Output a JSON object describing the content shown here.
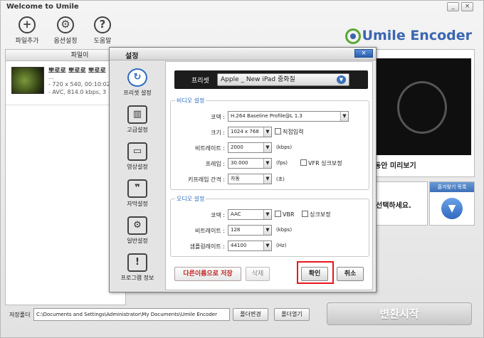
{
  "window": {
    "title": "Welcome to Umile",
    "min": "_",
    "close": "×"
  },
  "toolbar": {
    "add_file": "파일추가",
    "options": "옵션설정",
    "help": "도움말",
    "add_icon": "+",
    "options_icon": "⚙",
    "help_icon": "?"
  },
  "logo": {
    "text": "Umile Encoder",
    "accent": "#5aa832",
    "brand": "#3a66b0"
  },
  "file_panel": {
    "header": "파일이",
    "file": {
      "name": "뽀로로 뽀로로 뽀로로",
      "ellipsis": "...",
      "meta1": "- 720 x 540, 00:10:02",
      "meta2": "- AVC, 814.0 kbps, 3"
    }
  },
  "preview": {
    "caption": "동안 미리보기"
  },
  "middle": {
    "text": "선택하세요."
  },
  "favorites": {
    "header": "즐겨찾기 목록",
    "arrow": "▼"
  },
  "convert": {
    "label": "변환시작"
  },
  "savebar": {
    "label": "저장폴더",
    "path": "C:\\Documents and Settings\\Administrator\\My Documents\\Umile Encoder",
    "change": "폴더변경",
    "open": "폴더열기"
  },
  "dialog": {
    "title": "설정",
    "close": "×",
    "nav": [
      {
        "label": "프리셋 설정",
        "icon": "↻"
      },
      {
        "label": "고급설정",
        "icon": "▥"
      },
      {
        "label": "영상설정",
        "icon": "▭"
      },
      {
        "label": "자막설정",
        "icon": "❞"
      },
      {
        "label": "일반설정",
        "icon": "⚙"
      },
      {
        "label": "프로그램 정보",
        "icon": "!"
      }
    ],
    "preset": {
      "label": "프리셋",
      "value": "Apple _ New iPad 중화질",
      "arrow": "▼"
    },
    "video": {
      "title": "비디오 설정",
      "codec_label": "코덱 :",
      "codec": "H.264 Baseline Profile@L 1.3",
      "size_label": "크기 :",
      "size": "1024 x 768",
      "direct": "직접입력",
      "bitrate_label": "비트레이트 :",
      "bitrate": "2000",
      "bitrate_unit": "(kbps)",
      "frame_label": "프레임 :",
      "frame": "30.000",
      "frame_unit": "(fps)",
      "vfr": "VFR 싱크보정",
      "keyframe_label": "키프레임 간격 :",
      "keyframe": "자동",
      "keyframe_unit": "(초)"
    },
    "audio": {
      "title": "오디오 설정",
      "codec_label": "코덱 :",
      "codec": "AAC",
      "vbr": "VBR",
      "sync": "싱크보정",
      "bitrate_label": "비트레이트 :",
      "bitrate": "128",
      "bitrate_unit": "(kbps)",
      "sample_label": "샘플링레이트 :",
      "sample": "44100",
      "sample_unit": "(Hz)"
    },
    "buttons": {
      "save_as": "다른이름으로 저장",
      "delete": "삭제",
      "ok": "확인",
      "cancel": "취소"
    },
    "arrow": "▼"
  }
}
